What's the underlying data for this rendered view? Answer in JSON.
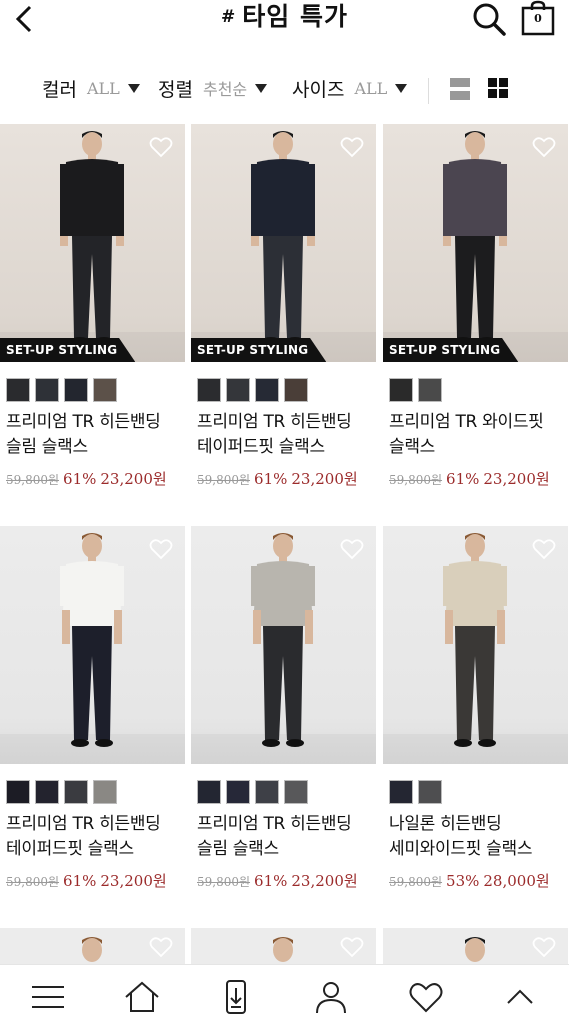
{
  "header": {
    "hash": "#",
    "title": "타임 특가",
    "cart_count": "0"
  },
  "filters": [
    {
      "label": "컬러",
      "value": "ALL"
    },
    {
      "label": "정렬",
      "value": "추천순"
    },
    {
      "label": "사이즈",
      "value": "ALL"
    }
  ],
  "badge": "SET-UP STYLING",
  "products": [
    {
      "name_line1": "프리미엄 TR 히든밴딩",
      "name_line2": "슬림 슬랙스",
      "orig": "59,800원",
      "disc": "61%",
      "price": "23,200원",
      "swatches": [
        "#2a2b2e",
        "#2e3137",
        "#23262f",
        "#5c5149"
      ],
      "badge": true
    },
    {
      "name_line1": "프리미엄 TR 히든밴딩",
      "name_line2": "테이퍼드핏 슬랙스",
      "orig": "59,800원",
      "disc": "61%",
      "price": "23,200원",
      "swatches": [
        "#2b2c2f",
        "#34363a",
        "#262a35",
        "#4a3e38"
      ],
      "badge": true
    },
    {
      "name_line1": "프리미엄 TR 와이드핏",
      "name_line2": "슬랙스",
      "orig": "59,800원",
      "disc": "61%",
      "price": "23,200원",
      "swatches": [
        "#2a2a2a",
        "#4a4a4a"
      ],
      "badge": true
    },
    {
      "name_line1": "프리미엄 TR 히든밴딩",
      "name_line2": "테이퍼드핏 슬랙스",
      "orig": "59,800원",
      "disc": "61%",
      "price": "23,200원",
      "swatches": [
        "#1c1c25",
        "#23232e",
        "#3a3b40",
        "#8a8884"
      ],
      "badge": false
    },
    {
      "name_line1": "프리미엄 TR 히든밴딩",
      "name_line2": "슬림 슬랙스",
      "orig": "59,800원",
      "disc": "61%",
      "price": "23,200원",
      "swatches": [
        "#232632",
        "#262838",
        "#3e4047",
        "#58585a"
      ],
      "badge": false
    },
    {
      "name_line1": "나일론 히든밴딩",
      "name_line2": "세미와이드핏 슬랙스",
      "orig": "59,800원",
      "disc": "53%",
      "price": "28,000원",
      "swatches": [
        "#242632",
        "#4e4e50"
      ],
      "badge": false
    }
  ],
  "nav": [
    "menu-icon",
    "home-icon",
    "download-icon",
    "user-icon",
    "heart-icon",
    "chevron-up-icon"
  ],
  "colors": {
    "accent_price": "#9b2b2b",
    "badge_bg": "#111111"
  }
}
